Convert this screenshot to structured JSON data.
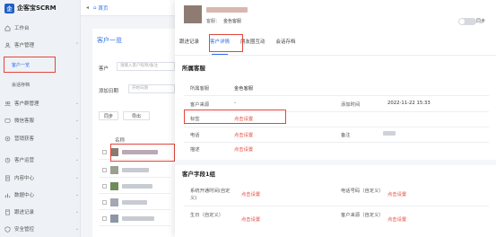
{
  "sidebar": {
    "brand": "企客宝SCRM",
    "items": [
      {
        "label": "工作台",
        "icon": "home-icon"
      },
      {
        "label": "客户管理",
        "icon": "customer-icon"
      },
      {
        "label": "客户群管理",
        "icon": "group-icon"
      },
      {
        "label": "微信客服",
        "icon": "chat-icon"
      },
      {
        "label": "营销获客",
        "icon": "marketing-icon"
      },
      {
        "label": "客户运营",
        "icon": "operation-icon"
      },
      {
        "label": "内容中心",
        "icon": "content-icon"
      },
      {
        "label": "数据中心",
        "icon": "data-icon"
      },
      {
        "label": "跟进记录",
        "icon": "record-icon"
      },
      {
        "label": "安全管控",
        "icon": "security-icon"
      }
    ],
    "subitems": [
      "客户一览",
      "会话存档"
    ]
  },
  "topbar": {
    "tab_label": "首页"
  },
  "list": {
    "title": "客户一览",
    "customer_label": "客户",
    "search_placeholder": "请输入客户昵称/备注",
    "add_date_label": "添加日期",
    "date_placeholder": "开始日期",
    "sync_label": "同步",
    "export_label": "导出",
    "name_col": "名称"
  },
  "drawer": {
    "remark_label": "客服：",
    "remark_value": "金色客服",
    "toggle_text": "同步",
    "tabs": [
      "跟进记录",
      "客户详情",
      "朋友圈互动",
      "会话存档"
    ],
    "active_tab": 1,
    "section1_title": "所属客服",
    "section1": {
      "owner_label": "所属客服",
      "owner_value": "金色客服",
      "source_label": "客户来源",
      "source_value": "-",
      "added_label": "添加时间",
      "added_value": "2022-11-22 15:33",
      "tag_label": "标签",
      "tag_link": "点击设置",
      "phone_label": "电话",
      "phone_link": "点击设置",
      "remark_label": "备注",
      "desc_label": "描述",
      "desc_link": "点击设置"
    },
    "section2_title": "客户字段1组",
    "section2": {
      "f1_label": "系统开通时间(自定义)",
      "f1_link": "点击设置",
      "f2_label": "电话号码（自定义）",
      "f2_link": "点击设置",
      "f3_label": "生日（自定义）",
      "f3_link": "点击设置",
      "f4_label": "客户来源（自定义）",
      "f4_link": "点击设置"
    }
  },
  "colors": {
    "accent": "#2b6fe6",
    "highlight_box": "#e2473b",
    "link": "#e2473b"
  }
}
